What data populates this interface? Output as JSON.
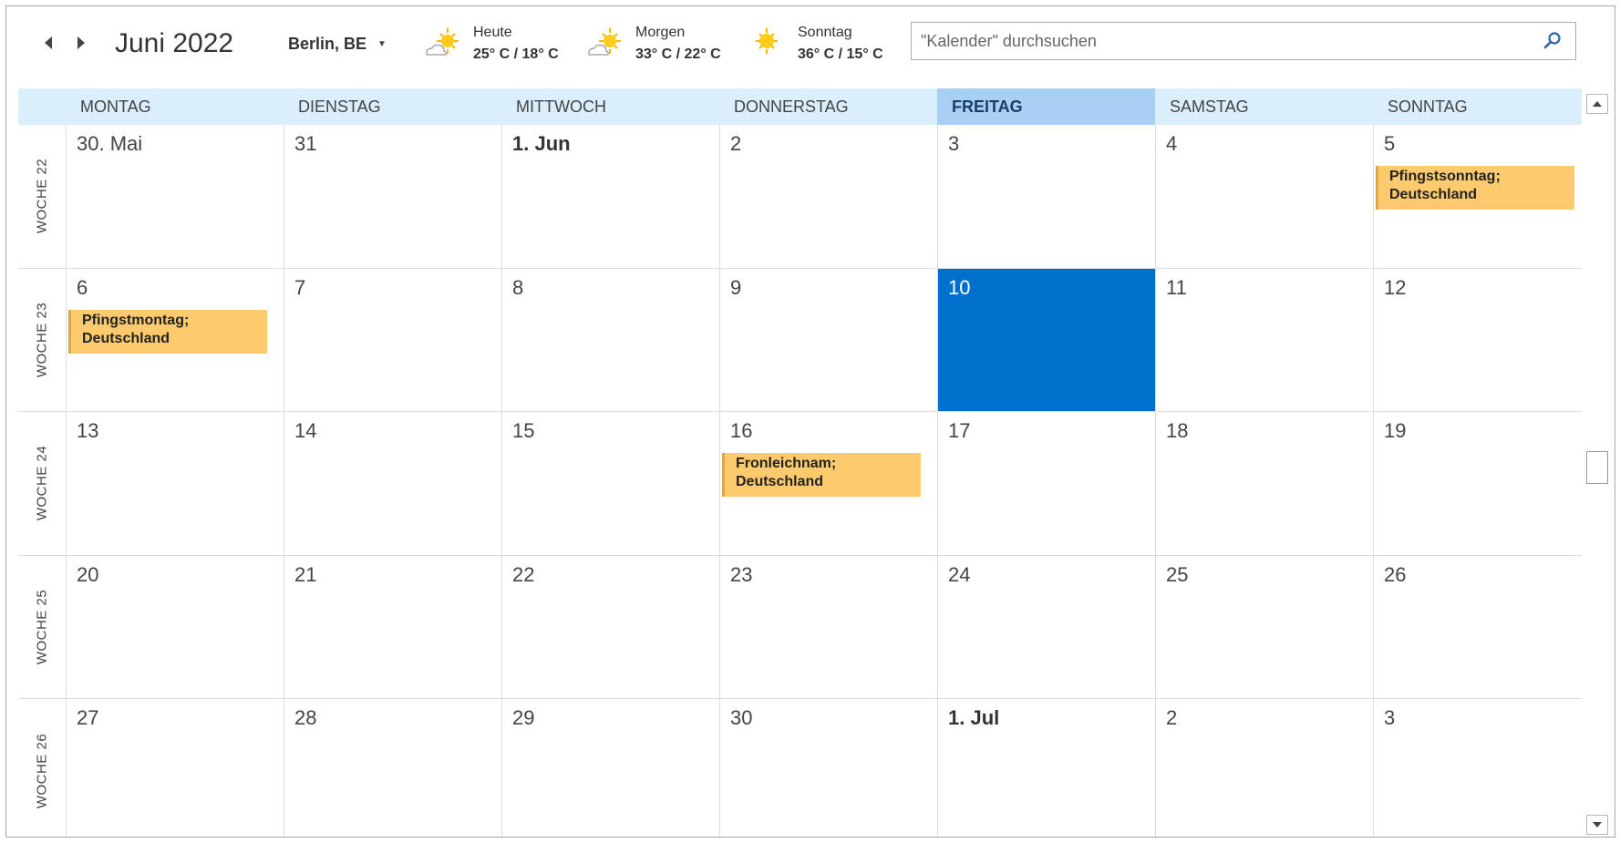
{
  "header": {
    "month_title": "Juni 2022",
    "location": "Berlin, BE",
    "weather": [
      {
        "day": "Heute",
        "temp": "25° C / 18° C",
        "icon": "partly-sunny-icon"
      },
      {
        "day": "Morgen",
        "temp": "33° C / 22° C",
        "icon": "partly-sunny-icon"
      },
      {
        "day": "Sonntag",
        "temp": "36° C / 15° C",
        "icon": "sunny-icon"
      }
    ],
    "search_placeholder": "\"Kalender\" durchsuchen"
  },
  "colors": {
    "accent": "#0070cc",
    "event": "#fdcb6e",
    "header_band": "#daeefb",
    "today_header": "#a8d0f4"
  },
  "days": [
    "MONTAG",
    "DIENSTAG",
    "MITTWOCH",
    "DONNERSTAG",
    "FREITAG",
    "SAMSTAG",
    "SONNTAG"
  ],
  "today_column": 4,
  "weeks": [
    {
      "label": "WOCHE 22",
      "dates": [
        "30. Mai",
        "31",
        "1. Jun",
        "2",
        "3",
        "4",
        "5"
      ]
    },
    {
      "label": "WOCHE 23",
      "dates": [
        "6",
        "7",
        "8",
        "9",
        "10",
        "11",
        "12"
      ]
    },
    {
      "label": "WOCHE 24",
      "dates": [
        "13",
        "14",
        "15",
        "16",
        "17",
        "18",
        "19"
      ]
    },
    {
      "label": "WOCHE 25",
      "dates": [
        "20",
        "21",
        "22",
        "23",
        "24",
        "25",
        "26"
      ]
    },
    {
      "label": "WOCHE 26",
      "dates": [
        "27",
        "28",
        "29",
        "30",
        "1. Jul",
        "2",
        "3"
      ]
    }
  ],
  "bold_dates": [
    [
      0,
      2
    ],
    [
      4,
      4
    ]
  ],
  "selected_cell": [
    1,
    4
  ],
  "events": [
    {
      "week": 0,
      "day": 6,
      "line1": "Pfingstsonntag;",
      "line2": "Deutschland"
    },
    {
      "week": 1,
      "day": 0,
      "line1": "Pfingstmontag;",
      "line2": "Deutschland"
    },
    {
      "week": 2,
      "day": 3,
      "line1": "Fronleichnam;",
      "line2": "Deutschland"
    }
  ]
}
